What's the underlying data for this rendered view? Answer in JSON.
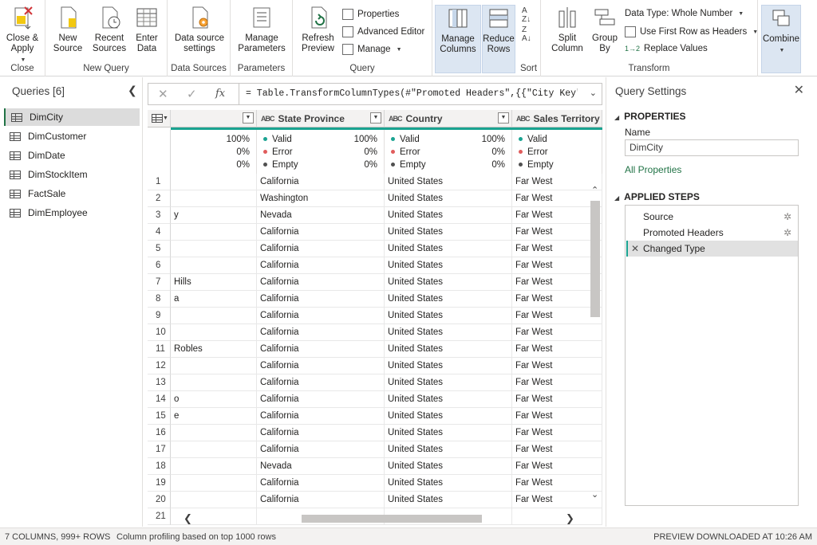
{
  "ribbon": {
    "close_group": {
      "btn": "Close & Apply",
      "label": "Close"
    },
    "new_query_group": {
      "new_source": "New Source",
      "recent_sources": "Recent Sources",
      "enter_data": "Enter Data",
      "label": "New Query"
    },
    "data_sources_group": {
      "btn": "Data source settings",
      "label": "Data Sources"
    },
    "parameters_group": {
      "btn": "Manage Parameters",
      "label": "Parameters"
    },
    "query_group": {
      "refresh": "Refresh Preview",
      "properties": "Properties",
      "advanced_editor": "Advanced Editor",
      "manage": "Manage",
      "label": "Query"
    },
    "columns_rows": {
      "manage_columns": "Manage Columns",
      "reduce_rows": "Reduce Rows"
    },
    "sort_group": {
      "label": "Sort"
    },
    "transform_group": {
      "split": "Split Column",
      "group_by": "Group By",
      "data_type": "Data Type: Whole Number",
      "first_row": "Use First Row as Headers",
      "replace": "Replace Values",
      "label": "Transform"
    },
    "combine": {
      "btn": "Combine"
    }
  },
  "queries": {
    "title": "Queries [6]",
    "items": [
      "DimCity",
      "DimCustomer",
      "DimDate",
      "DimStockItem",
      "FactSale",
      "DimEmployee"
    ]
  },
  "formula": {
    "text": "= Table.TransformColumnTypes(#\"Promoted Headers\",{{\"City Key\","
  },
  "grid": {
    "columns": [
      "State Province",
      "Country",
      "Sales Territory"
    ],
    "first_col_profile": [
      "100%",
      "0%",
      "0%"
    ],
    "profile": {
      "labels": [
        "Valid",
        "Error",
        "Empty"
      ],
      "values": [
        "100%",
        "0%",
        "0%"
      ]
    },
    "rows": [
      {
        "n": "1",
        "c0": "",
        "c1": "California",
        "c2": "United States",
        "c3": "Far West"
      },
      {
        "n": "2",
        "c0": "",
        "c1": "Washington",
        "c2": "United States",
        "c3": "Far West"
      },
      {
        "n": "3",
        "c0": "y",
        "c1": "Nevada",
        "c2": "United States",
        "c3": "Far West"
      },
      {
        "n": "4",
        "c0": "",
        "c1": "California",
        "c2": "United States",
        "c3": "Far West"
      },
      {
        "n": "5",
        "c0": "",
        "c1": "California",
        "c2": "United States",
        "c3": "Far West"
      },
      {
        "n": "6",
        "c0": "",
        "c1": "California",
        "c2": "United States",
        "c3": "Far West"
      },
      {
        "n": "7",
        "c0": "Hills",
        "c1": "California",
        "c2": "United States",
        "c3": "Far West"
      },
      {
        "n": "8",
        "c0": "a",
        "c1": "California",
        "c2": "United States",
        "c3": "Far West"
      },
      {
        "n": "9",
        "c0": "",
        "c1": "California",
        "c2": "United States",
        "c3": "Far West"
      },
      {
        "n": "10",
        "c0": "",
        "c1": "California",
        "c2": "United States",
        "c3": "Far West"
      },
      {
        "n": "11",
        "c0": "Robles",
        "c1": "California",
        "c2": "United States",
        "c3": "Far West"
      },
      {
        "n": "12",
        "c0": "",
        "c1": "California",
        "c2": "United States",
        "c3": "Far West"
      },
      {
        "n": "13",
        "c0": "",
        "c1": "California",
        "c2": "United States",
        "c3": "Far West"
      },
      {
        "n": "14",
        "c0": "o",
        "c1": "California",
        "c2": "United States",
        "c3": "Far West"
      },
      {
        "n": "15",
        "c0": "e",
        "c1": "California",
        "c2": "United States",
        "c3": "Far West"
      },
      {
        "n": "16",
        "c0": "",
        "c1": "California",
        "c2": "United States",
        "c3": "Far West"
      },
      {
        "n": "17",
        "c0": "",
        "c1": "California",
        "c2": "United States",
        "c3": "Far West"
      },
      {
        "n": "18",
        "c0": "",
        "c1": "Nevada",
        "c2": "United States",
        "c3": "Far West"
      },
      {
        "n": "19",
        "c0": "",
        "c1": "California",
        "c2": "United States",
        "c3": "Far West"
      },
      {
        "n": "20",
        "c0": "",
        "c1": "California",
        "c2": "United States",
        "c3": "Far West"
      },
      {
        "n": "21",
        "c0": "",
        "c1": "",
        "c2": "",
        "c3": ""
      }
    ]
  },
  "settings": {
    "title": "Query Settings",
    "properties": "PROPERTIES",
    "name_label": "Name",
    "name_value": "DimCity",
    "all_properties": "All Properties",
    "applied_steps": "APPLIED STEPS",
    "steps": [
      "Source",
      "Promoted Headers",
      "Changed Type"
    ]
  },
  "status": {
    "counts": "7 COLUMNS, 999+ ROWS",
    "profiling": "Column profiling based on top 1000 rows",
    "preview": "PREVIEW DOWNLOADED AT 10:26 AM"
  },
  "colors": {
    "accent": "#1aa391",
    "error": "#e05c5c",
    "empty": "#505050",
    "brand": "#217346"
  },
  "icons": [
    "close-apply-icon",
    "new-source-icon",
    "recent-sources-icon",
    "enter-data-icon",
    "gear-doc-icon",
    "parameters-icon",
    "refresh-icon",
    "properties-icon",
    "advanced-editor-icon",
    "manage-icon",
    "manage-columns-icon",
    "reduce-rows-icon",
    "sort-asc-icon",
    "sort-desc-icon",
    "split-column-icon",
    "group-by-icon",
    "first-row-icon",
    "replace-values-icon",
    "combine-icon",
    "table-icon",
    "gear-icon",
    "close-icon"
  ]
}
